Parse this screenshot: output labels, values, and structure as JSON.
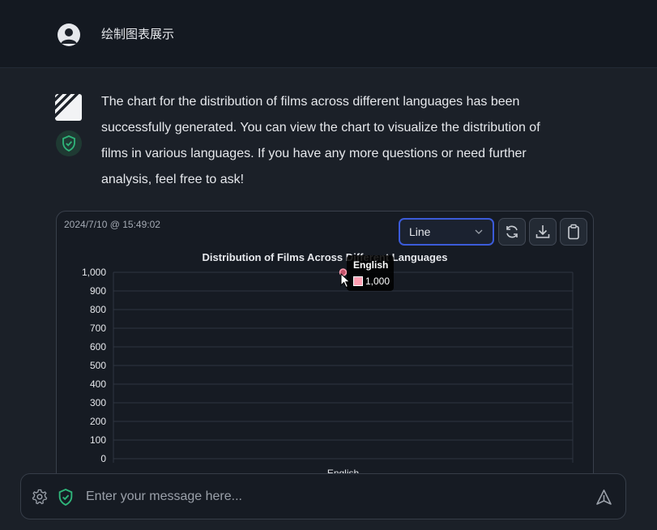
{
  "header": {
    "user_message": "绘制图表展示"
  },
  "assistant": {
    "message_lines": [
      "The chart for the distribution of films across different languages has been",
      "successfully generated. You can view the chart to visualize the distribution of",
      "films in various languages. If you have any more questions or need further",
      "analysis, feel free to ask!"
    ]
  },
  "chart_card": {
    "timestamp": "2024/7/10 @ 15:49:02",
    "chart_type_select": "Line",
    "icons": [
      "refresh-icon",
      "download-icon",
      "clipboard-icon"
    ]
  },
  "chart_data": {
    "type": "line",
    "title": "Distribution of Films Across Different Languages",
    "categories": [
      "English"
    ],
    "series": [
      {
        "values": [
          1000
        ]
      }
    ],
    "ylim": [
      0,
      1000
    ],
    "yticks": [
      "0",
      "100",
      "200",
      "300",
      "400",
      "500",
      "600",
      "700",
      "800",
      "900",
      "1,000"
    ],
    "grid": true,
    "point_color": "#ff9fb2",
    "tooltip": {
      "title": "English",
      "value": "1,000"
    }
  },
  "composer": {
    "placeholder": "Enter your message here...",
    "icons": [
      "gear-icon",
      "shield-check-icon",
      "send-icon"
    ]
  },
  "colors": {
    "background": "#1b2028",
    "header": "#141921",
    "accent": "#3b5bd9",
    "shield": "#2fb57a"
  }
}
